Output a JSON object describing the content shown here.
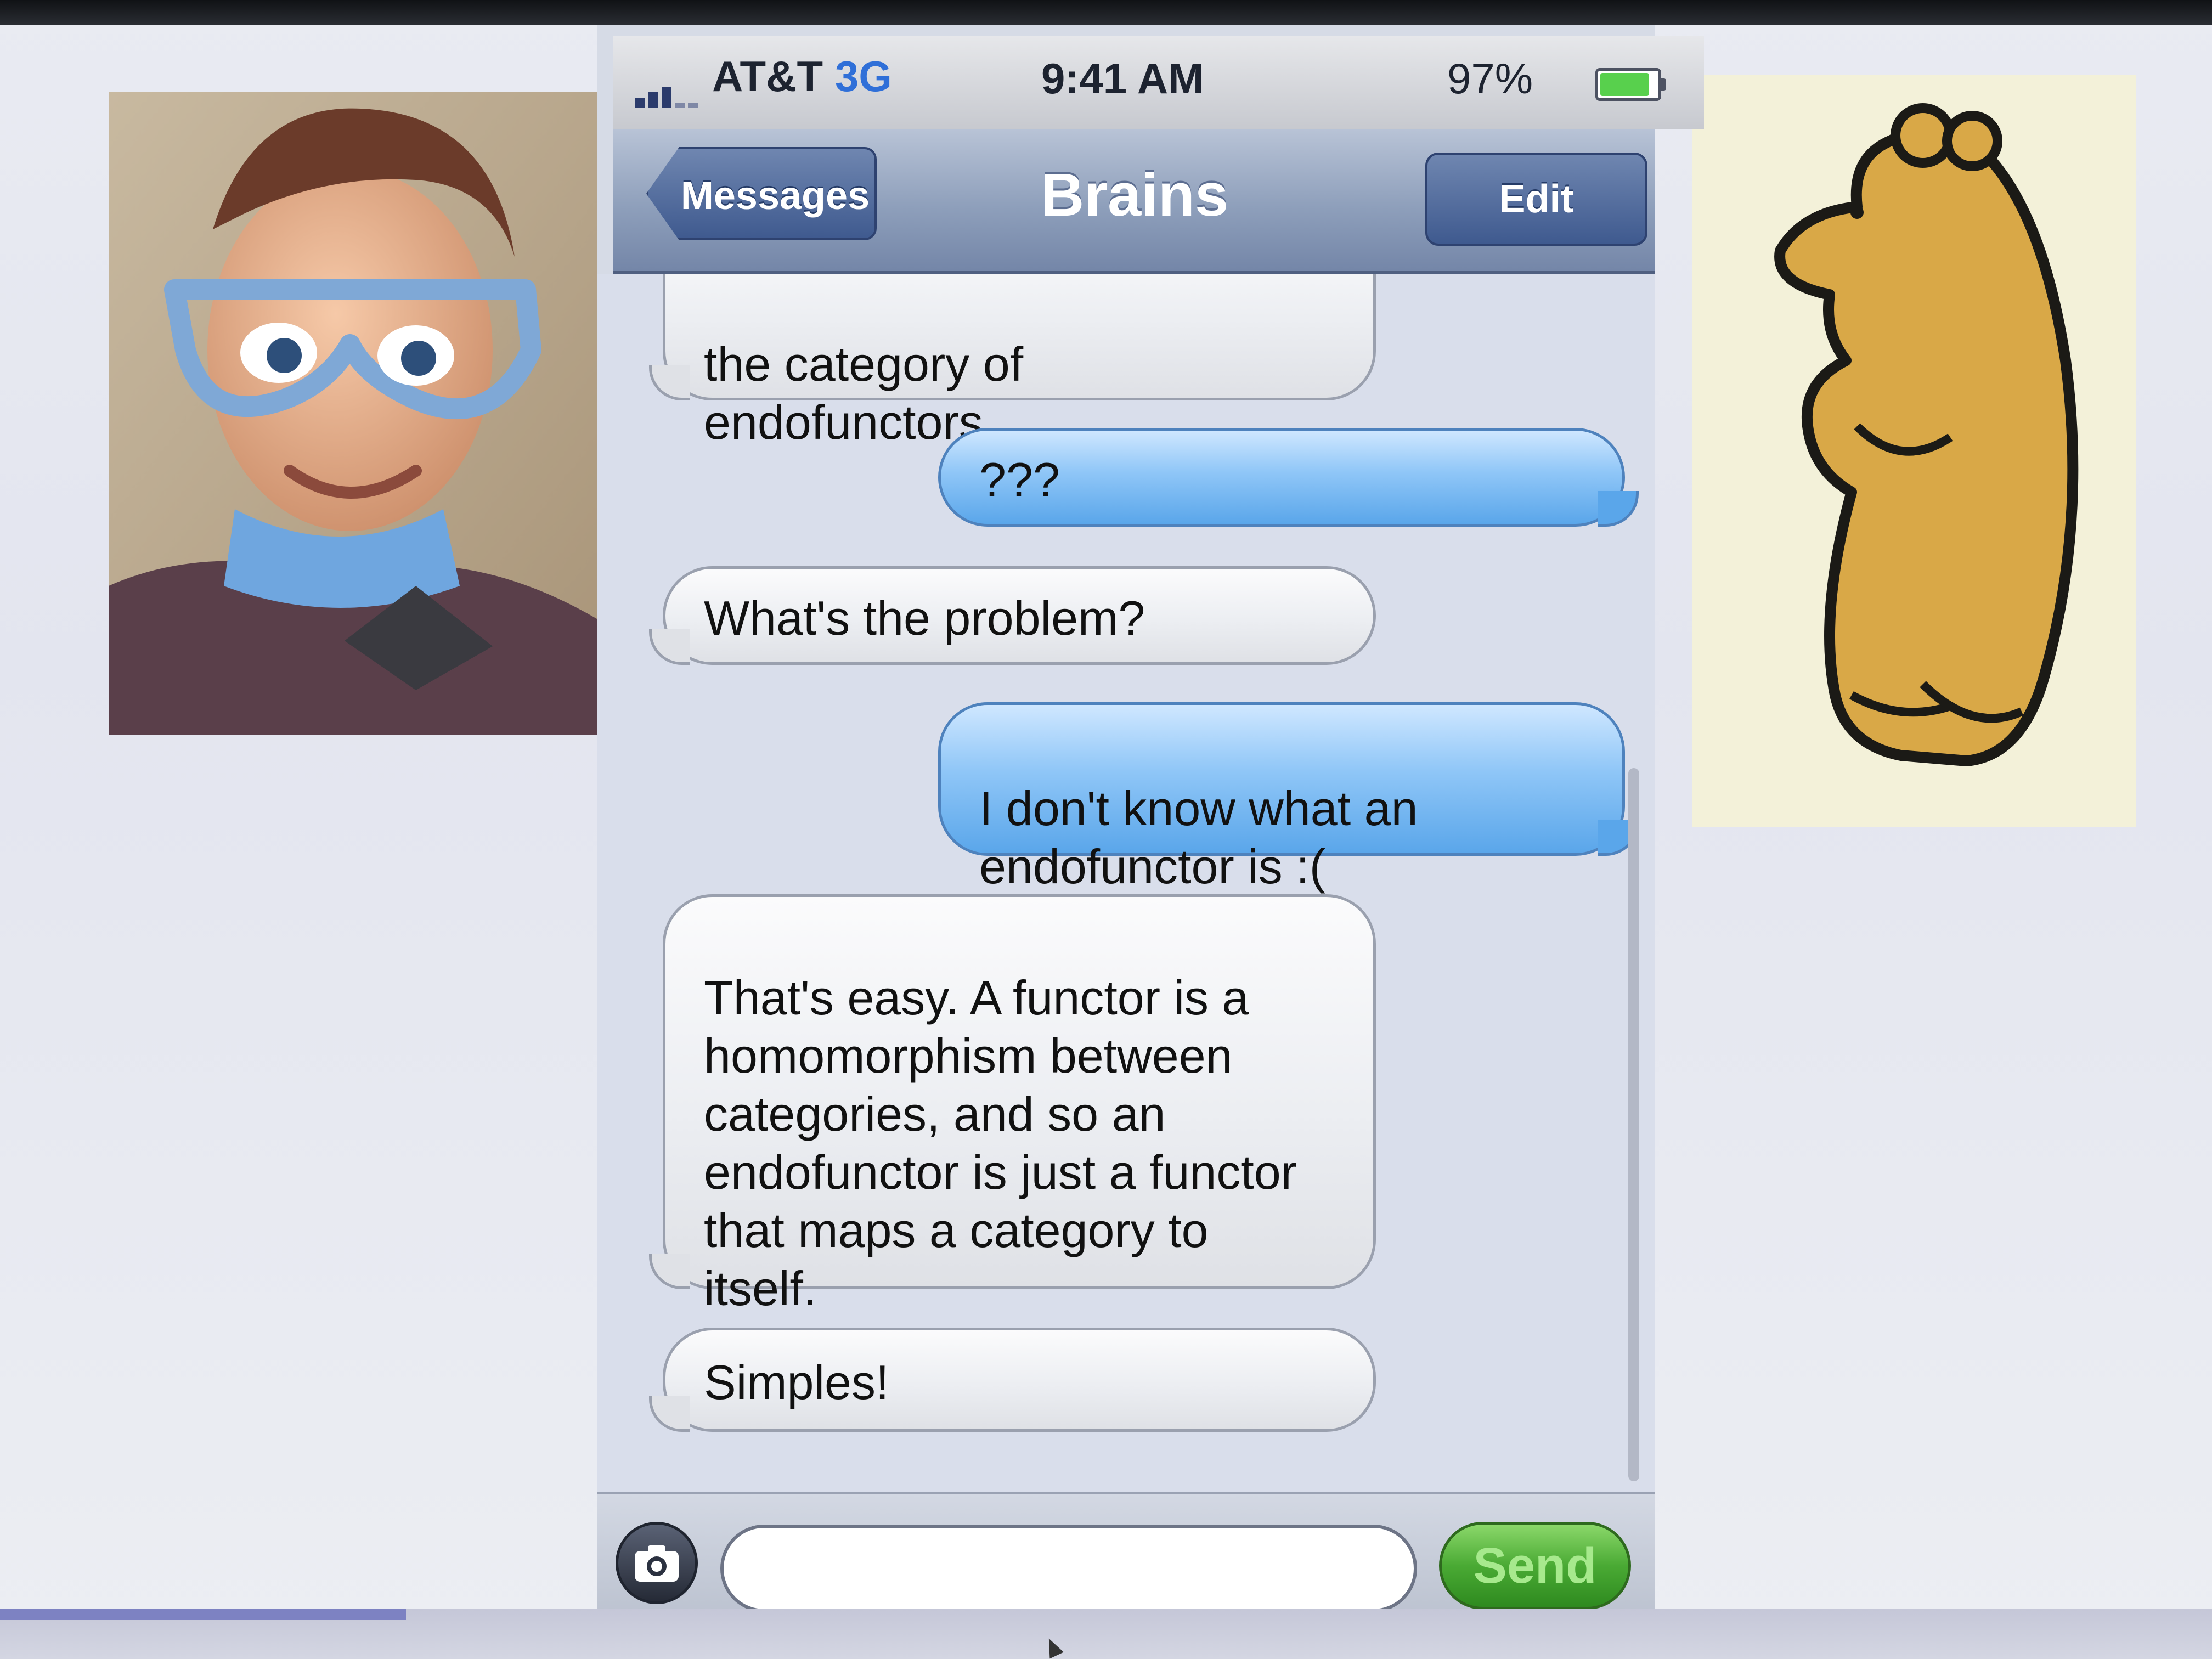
{
  "status_bar": {
    "carrier": "AT&T",
    "network": "3G",
    "time": "9:41 AM",
    "battery_percent": "97%",
    "battery_level": 0.97
  },
  "nav": {
    "back_label": "Messages",
    "title": "Brains",
    "edit_label": "Edit"
  },
  "messages": [
    {
      "side": "in",
      "text": "the category of\nendofunctors."
    },
    {
      "side": "out",
      "text": "???"
    },
    {
      "side": "in",
      "text": "What's the problem?"
    },
    {
      "side": "out",
      "text": "I don't know what an\nendofunctor is :("
    },
    {
      "side": "in",
      "text": "That's easy. A functor is a\nhomomorphism between\ncategories, and so an\nendofunctor is just a functor\nthat maps a category to\nitself."
    },
    {
      "side": "in",
      "text": "Simples!"
    }
  ],
  "compose": {
    "input_value": "",
    "send_label": "Send"
  },
  "colors": {
    "nav_bar": "#8e9fbb",
    "outgoing_bubble": "#8fc6f7",
    "incoming_bubble": "#eceef2",
    "send_button": "#4aaa34"
  },
  "icons": {
    "camera": "camera-icon",
    "signal": "signal-bars-icon",
    "battery": "battery-icon"
  }
}
